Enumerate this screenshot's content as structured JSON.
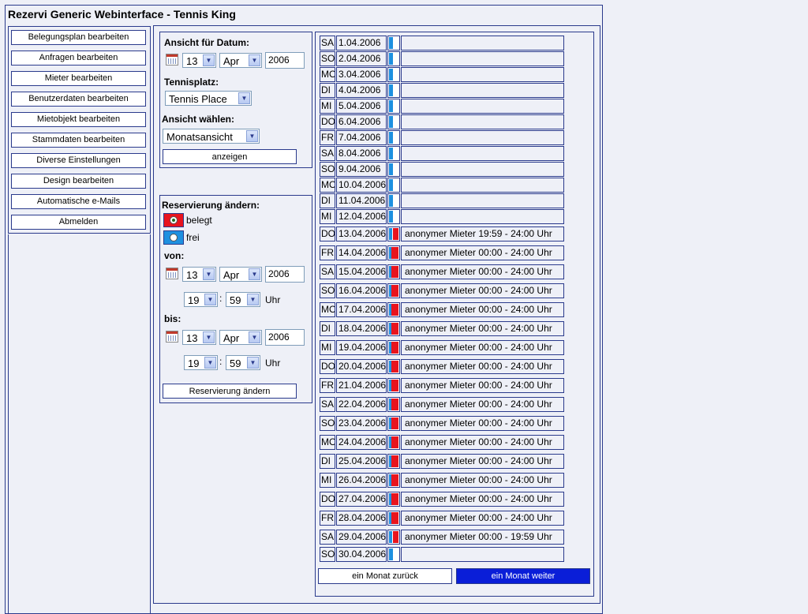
{
  "app_title": "Rezervi Generic Webinterface - Tennis King",
  "menu": [
    "Belegungsplan bearbeiten",
    "Anfragen bearbeiten",
    "Mieter bearbeiten",
    "Benutzerdaten bearbeiten",
    "Mietobjekt bearbeiten",
    "Stammdaten bearbeiten",
    "Diverse Einstellungen",
    "Design bearbeiten",
    "Automatische e-Mails",
    "Abmelden"
  ],
  "view": {
    "date_label": "Ansicht für Datum:",
    "day": "13",
    "month": "Apr",
    "year": "2006",
    "court_label": "Tennisplatz:",
    "court": "Tennis Place",
    "mode_label": "Ansicht wählen:",
    "mode": "Monatsansicht",
    "show_button": "anzeigen"
  },
  "reservation": {
    "heading": "Reservierung ändern:",
    "belegt_label": "belegt",
    "frei_label": "frei",
    "von_label": "von:",
    "von_day": "13",
    "von_month": "Apr",
    "von_year": "2006",
    "von_hour": "19",
    "von_minute": "59",
    "bis_label": "bis:",
    "bis_day": "13",
    "bis_month": "Apr",
    "bis_year": "2006",
    "bis_hour": "19",
    "bis_minute": "59",
    "time_sep": ":",
    "uhr": "Uhr",
    "submit_button": "Reservierung ändern"
  },
  "colors": {
    "belegt": "#e8141e",
    "frei": "#1e90e0",
    "accent": "#0a1ed8",
    "border": "#2a3a8c"
  },
  "calendar": {
    "days": [
      {
        "wd": "SA",
        "date": "1.04.2006",
        "status": "frei",
        "info": ""
      },
      {
        "wd": "SO",
        "date": "2.04.2006",
        "status": "frei",
        "info": ""
      },
      {
        "wd": "MO",
        "date": "3.04.2006",
        "status": "frei",
        "info": ""
      },
      {
        "wd": "DI",
        "date": "4.04.2006",
        "status": "frei",
        "info": ""
      },
      {
        "wd": "MI",
        "date": "5.04.2006",
        "status": "frei",
        "info": ""
      },
      {
        "wd": "DO",
        "date": "6.04.2006",
        "status": "frei",
        "info": ""
      },
      {
        "wd": "FR",
        "date": "7.04.2006",
        "status": "frei",
        "info": ""
      },
      {
        "wd": "SA",
        "date": "8.04.2006",
        "status": "frei",
        "info": ""
      },
      {
        "wd": "SO",
        "date": "9.04.2006",
        "status": "frei",
        "info": ""
      },
      {
        "wd": "MO",
        "date": "10.04.2006",
        "status": "frei",
        "info": ""
      },
      {
        "wd": "DI",
        "date": "11.04.2006",
        "status": "frei",
        "info": ""
      },
      {
        "wd": "MI",
        "date": "12.04.2006",
        "status": "frei",
        "info": ""
      },
      {
        "wd": "DO",
        "date": "13.04.2006",
        "status": "mixed",
        "info": "anonymer Mieter  19:59 - 24:00 Uhr"
      },
      {
        "wd": "FR",
        "date": "14.04.2006",
        "status": "belegt",
        "info": "anonymer Mieter  00:00 - 24:00 Uhr"
      },
      {
        "wd": "SA",
        "date": "15.04.2006",
        "status": "belegt",
        "info": "anonymer Mieter  00:00 - 24:00 Uhr"
      },
      {
        "wd": "SO",
        "date": "16.04.2006",
        "status": "belegt",
        "info": "anonymer Mieter  00:00 - 24:00 Uhr"
      },
      {
        "wd": "MO",
        "date": "17.04.2006",
        "status": "belegt",
        "info": "anonymer Mieter  00:00 - 24:00 Uhr"
      },
      {
        "wd": "DI",
        "date": "18.04.2006",
        "status": "belegt",
        "info": "anonymer Mieter  00:00 - 24:00 Uhr"
      },
      {
        "wd": "MI",
        "date": "19.04.2006",
        "status": "belegt",
        "info": "anonymer Mieter  00:00 - 24:00 Uhr"
      },
      {
        "wd": "DO",
        "date": "20.04.2006",
        "status": "belegt",
        "info": "anonymer Mieter  00:00 - 24:00 Uhr"
      },
      {
        "wd": "FR",
        "date": "21.04.2006",
        "status": "belegt",
        "info": "anonymer Mieter  00:00 - 24:00 Uhr"
      },
      {
        "wd": "SA",
        "date": "22.04.2006",
        "status": "belegt",
        "info": "anonymer Mieter  00:00 - 24:00 Uhr"
      },
      {
        "wd": "SO",
        "date": "23.04.2006",
        "status": "belegt",
        "info": "anonymer Mieter  00:00 - 24:00 Uhr"
      },
      {
        "wd": "MO",
        "date": "24.04.2006",
        "status": "belegt",
        "info": "anonymer Mieter  00:00 - 24:00 Uhr"
      },
      {
        "wd": "DI",
        "date": "25.04.2006",
        "status": "belegt",
        "info": "anonymer Mieter  00:00 - 24:00 Uhr"
      },
      {
        "wd": "MI",
        "date": "26.04.2006",
        "status": "belegt",
        "info": "anonymer Mieter  00:00 - 24:00 Uhr"
      },
      {
        "wd": "DO",
        "date": "27.04.2006",
        "status": "belegt",
        "info": "anonymer Mieter  00:00 - 24:00 Uhr"
      },
      {
        "wd": "FR",
        "date": "28.04.2006",
        "status": "belegt",
        "info": "anonymer Mieter  00:00 - 24:00 Uhr"
      },
      {
        "wd": "SA",
        "date": "29.04.2006",
        "status": "mixed",
        "info": "anonymer Mieter  00:00 - 19:59 Uhr"
      },
      {
        "wd": "SO",
        "date": "30.04.2006",
        "status": "frei",
        "info": ""
      }
    ],
    "prev_button": "ein Monat zurück",
    "next_button": "ein Monat weiter"
  }
}
